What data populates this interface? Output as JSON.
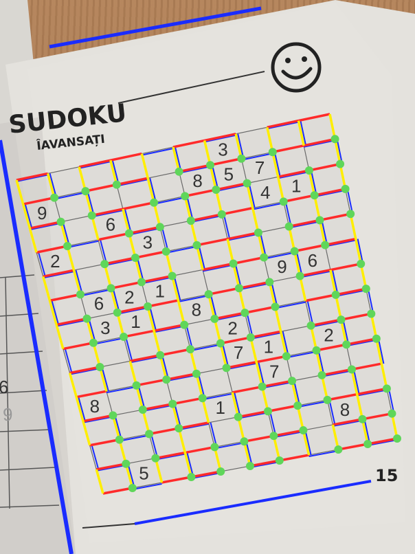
{
  "header": {
    "title": "SUDOKU",
    "subtitle": "ÎAVANSAȚI",
    "face_icon": "smiley-face-icon"
  },
  "page_number": "15",
  "left_page_digits": [
    "6",
    "9"
  ],
  "grid": {
    "rows": [
      [
        "",
        "",
        "",
        "",
        "",
        "",
        "3",
        "",
        "",
        ""
      ],
      [
        "9",
        "",
        "",
        "",
        "",
        "8",
        "5",
        "7",
        "",
        ""
      ],
      [
        "",
        "",
        "6",
        "",
        "",
        "",
        "",
        "4",
        "1",
        ""
      ],
      [
        "2",
        "",
        "",
        "3",
        "",
        "",
        "",
        "",
        "",
        ""
      ],
      [
        "",
        "",
        "",
        "",
        "",
        "",
        "",
        "",
        "",
        ""
      ],
      [
        "",
        "6",
        "2",
        "1",
        "",
        "",
        "",
        "9",
        "6",
        ""
      ],
      [
        "",
        "3",
        "1",
        "",
        "8",
        "",
        "",
        "",
        "",
        ""
      ],
      [
        "",
        "",
        "",
        "",
        "",
        "2",
        "",
        "",
        "",
        ""
      ],
      [
        "",
        "",
        "",
        "",
        "",
        "7",
        "1",
        "",
        "2",
        ""
      ],
      [
        "8",
        "",
        "",
        "",
        "",
        "",
        "7",
        "",
        "",
        ""
      ],
      [
        "",
        "",
        "",
        "",
        "1",
        "",
        "",
        "",
        "",
        ""
      ],
      [
        "",
        "",
        "",
        "",
        "",
        "",
        "",
        "",
        "8",
        ""
      ],
      [
        "",
        "5",
        "",
        "",
        "",
        "",
        "",
        "",
        "",
        ""
      ]
    ]
  },
  "overlay_colors": {
    "horizontal_line": "#ff2a2a",
    "vertical_line": "#ffee00",
    "cell_edge": "#1a2cff",
    "intersection_dot": "#5fd65a"
  }
}
